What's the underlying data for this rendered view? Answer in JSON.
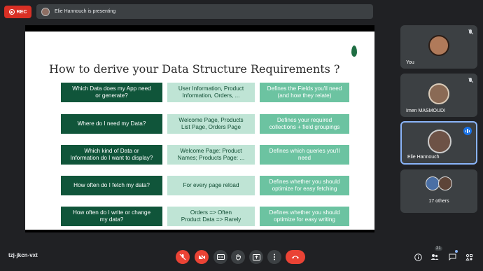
{
  "top": {
    "rec_label": "REC",
    "presenting_text": "Elie Hannouch is presenting"
  },
  "slide": {
    "title": "How to derive your Data Structure Requirements ?",
    "rows": [
      {
        "question": "Which Data does my App need\nor generate?",
        "example": "User Information, Product\nInformation, Orders, ...",
        "meaning": "Defines the Fields you'll need\n(and how they relate)"
      },
      {
        "question": "Where do I need my Data?",
        "example": "Welcome Page, Products\nList Page, Orders Page",
        "meaning": "Defines your required\ncollections + field groupings"
      },
      {
        "question": "Which kind of Data or\nInformation do I want to display?",
        "example": "Welcome Page: Product\nNames; Products Page: ...",
        "meaning": "Defines which queries you'll\nneed"
      },
      {
        "question": "How often do I fetch my data?",
        "example": "For every page reload",
        "meaning": "Defines whether you should\noptimize for easy fetching"
      },
      {
        "question": "How often do I write or change\nmy data?",
        "example": "Orders => Often\nProduct Data => Rarely",
        "meaning": "Defines whether you should\noptimize for easy writing"
      }
    ]
  },
  "participants": {
    "you": "You",
    "imen": "Imen MASMOUDI",
    "elie": "Elie Hannouch",
    "others": "17 others"
  },
  "bottom": {
    "meeting_code": "tzj-jkcn-vxt",
    "people_count": "21"
  },
  "colors": {
    "dark_green": "#10553a",
    "light_green": "#bfe4d5",
    "mid_green": "#6cc3a1",
    "end_call_red": "#ea4335",
    "active_border": "#8ab4f8"
  }
}
